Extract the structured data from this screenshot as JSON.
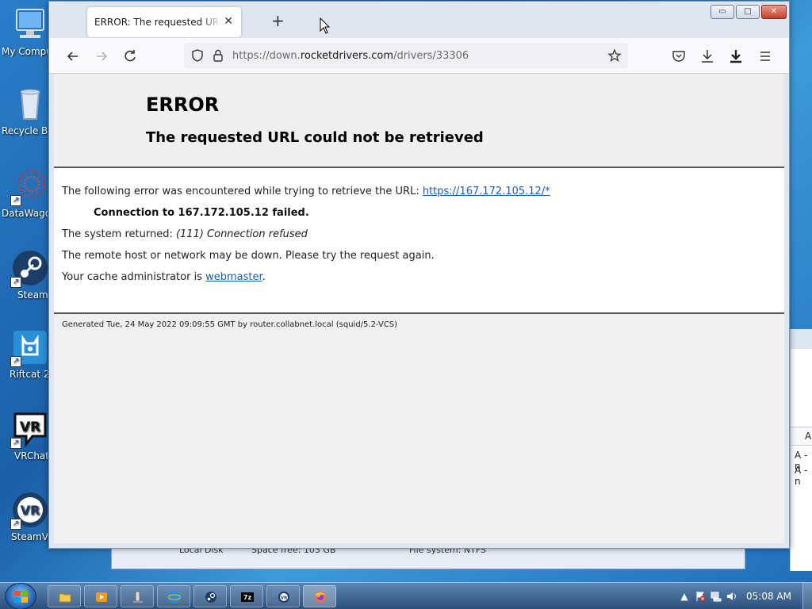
{
  "desktop": {
    "icons": [
      {
        "label": "My Compu",
        "name": "my-computer"
      },
      {
        "label": "Recycle B",
        "name": "recycle-bin"
      },
      {
        "label": "DataWagon",
        "name": "datawagon"
      },
      {
        "label": "Steam",
        "name": "steam"
      },
      {
        "label": "Riftcat 2.",
        "name": "riftcat"
      },
      {
        "label": "VRChat",
        "name": "vrchat"
      },
      {
        "label": "SteamVR",
        "name": "steamvr"
      }
    ]
  },
  "background_window": {
    "disk_label": "Local Disk",
    "space_free": "Space free: 103 GB",
    "file_system": "File system: NTFS",
    "column_header": "A",
    "rows": [
      "A -n",
      "A -n"
    ]
  },
  "browser": {
    "tab_title": "ERROR: The requested URL could not be retrieved",
    "new_tab": "+",
    "url": {
      "scheme": "https://down.",
      "host": "rocketdrivers.com",
      "path": "/drivers/33306"
    },
    "window_buttons": {
      "minimize": "▭",
      "maximize": "□",
      "close": "✕"
    }
  },
  "page": {
    "heading": "ERROR",
    "subheading": "The requested URL could not be retrieved",
    "error_intro": "The following error was encountered while trying to retrieve the URL: ",
    "error_url": "https://167.172.105.12/*",
    "connection_failed": "Connection to 167.172.105.12 failed.",
    "system_returned_label": "The system returned: ",
    "system_returned_value": "(111) Connection refused",
    "remote_host_msg": "The remote host or network may be down. Please try the request again.",
    "cache_admin_prefix": "Your cache administrator is ",
    "cache_admin_link": "webmaster",
    "cache_admin_suffix": ".",
    "footer": "Generated Tue, 24 May 2022 09:09:55 GMT by router.collabnet.local (squid/5.2-VCS)"
  },
  "taskbar": {
    "clock": "05:08 AM",
    "items": [
      "explorer",
      "media-player",
      "device",
      "internet-explorer",
      "steam",
      "7zip",
      "steamvr",
      "firefox"
    ]
  },
  "colors": {
    "link": "#1a5fb4",
    "page_bg": "#f0f0f0"
  }
}
